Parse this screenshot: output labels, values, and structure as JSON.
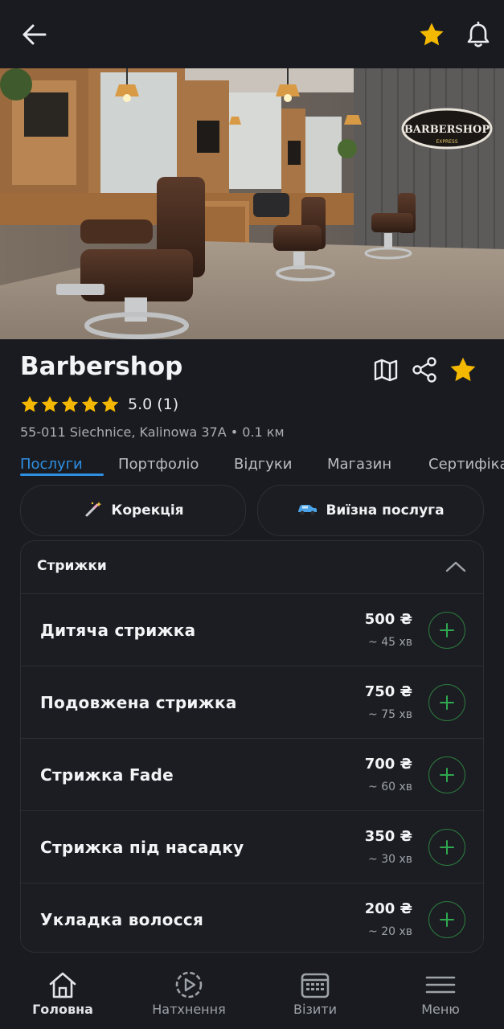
{
  "business": {
    "name": "Barbershop",
    "rating_text": "5.0 (1)",
    "stars": 5,
    "address": "55-011 Siechnice, Kalinowa 37A • 0.1 км",
    "sign_text": "BARBERSHOP",
    "sign_sub": "EXPRESS"
  },
  "tabs": [
    "Послуги",
    "Портфоліо",
    "Відгуки",
    "Магазин",
    "Сертифіка"
  ],
  "chips": [
    {
      "label": "Корекція",
      "icon": "magic-wand-icon"
    },
    {
      "label": "Виїзна послуга",
      "icon": "car-icon"
    }
  ],
  "category": {
    "label": "Стрижки",
    "expanded": true
  },
  "services": [
    {
      "name": "Дитяча стрижка",
      "price": "500 ₴",
      "duration": "~ 45 хв"
    },
    {
      "name": "Подовжена стрижка",
      "price": "750 ₴",
      "duration": "~ 75 хв"
    },
    {
      "name": "Стрижка Fade",
      "price": "700 ₴",
      "duration": "~ 60 хв"
    },
    {
      "name": "Стрижка під насадку",
      "price": "350 ₴",
      "duration": "~ 30 хв"
    },
    {
      "name": "Укладка волосся",
      "price": "200 ₴",
      "duration": "~ 20 хв"
    }
  ],
  "bottom_nav": [
    {
      "label": "Головна",
      "icon": "home-icon",
      "active": true
    },
    {
      "label": "Натхнення",
      "icon": "play-icon",
      "active": false
    },
    {
      "label": "Візити",
      "icon": "calendar-icon",
      "active": false
    },
    {
      "label": "Меню",
      "icon": "menu-icon",
      "active": false
    }
  ],
  "colors": {
    "background": "#191b20",
    "accent_blue": "#2e8fe3",
    "star_yellow": "#f5b800",
    "add_green": "#2fa84f"
  }
}
